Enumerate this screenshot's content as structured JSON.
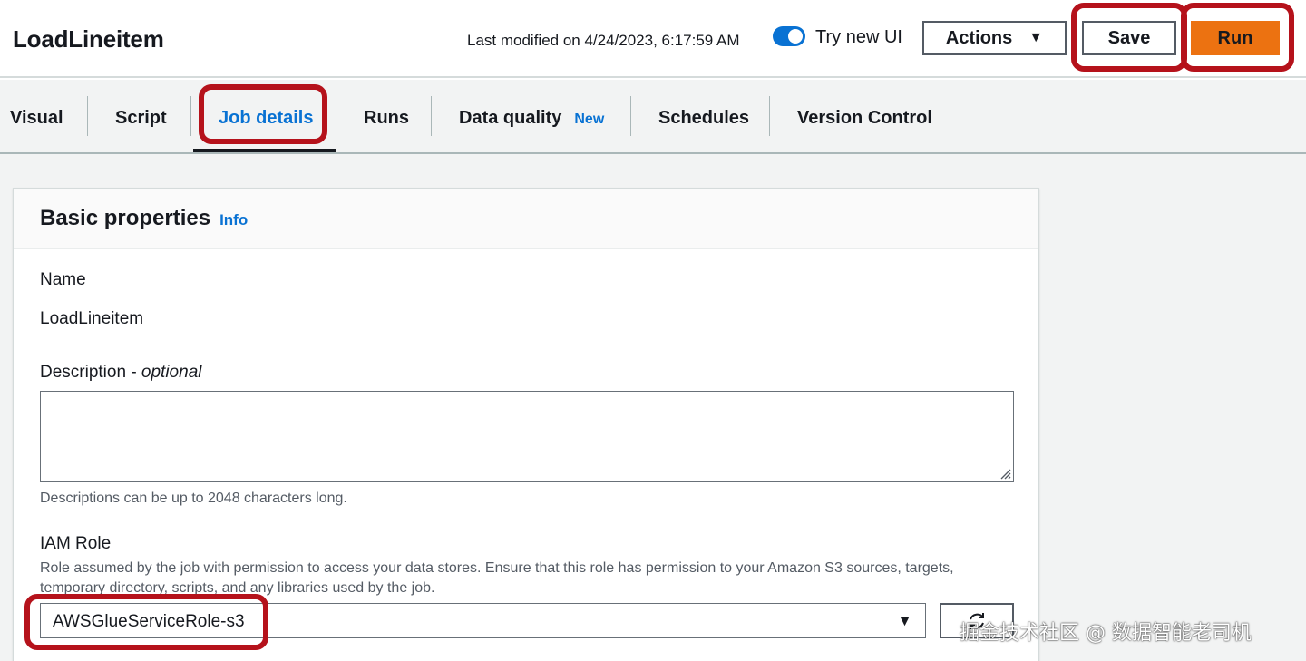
{
  "header": {
    "job_title": "LoadLineitem",
    "last_modified": "Last modified on 4/24/2023, 6:17:59 AM",
    "toggle_label": "Try new UI",
    "toggle_on": true,
    "actions_label": "Actions",
    "save_label": "Save",
    "run_label": "Run"
  },
  "tabs": [
    {
      "label": "Visual"
    },
    {
      "label": "Script"
    },
    {
      "label": "Job details",
      "active": true
    },
    {
      "label": "Runs"
    },
    {
      "label": "Data quality",
      "badge": "New"
    },
    {
      "label": "Schedules"
    },
    {
      "label": "Version Control"
    }
  ],
  "panel": {
    "title": "Basic properties",
    "info_label": "Info",
    "name_label": "Name",
    "name_value": "LoadLineitem",
    "description_label": "Description - ",
    "description_optional": "optional",
    "description_value": "",
    "description_hint": "Descriptions can be up to 2048 characters long.",
    "iam_label": "IAM Role",
    "iam_description": "Role assumed by the job with permission to access your data stores. Ensure that this role has permission to your Amazon S3 sources, targets, temporary directory, scripts, and any libraries used by the job.",
    "iam_value": "AWSGlueServiceRole-s3"
  },
  "watermark": "掘金技术社区 @ 数据智能老司机",
  "colors": {
    "accent": "#0972d3",
    "run_button": "#ec7211",
    "annotation": "#b5121b"
  }
}
